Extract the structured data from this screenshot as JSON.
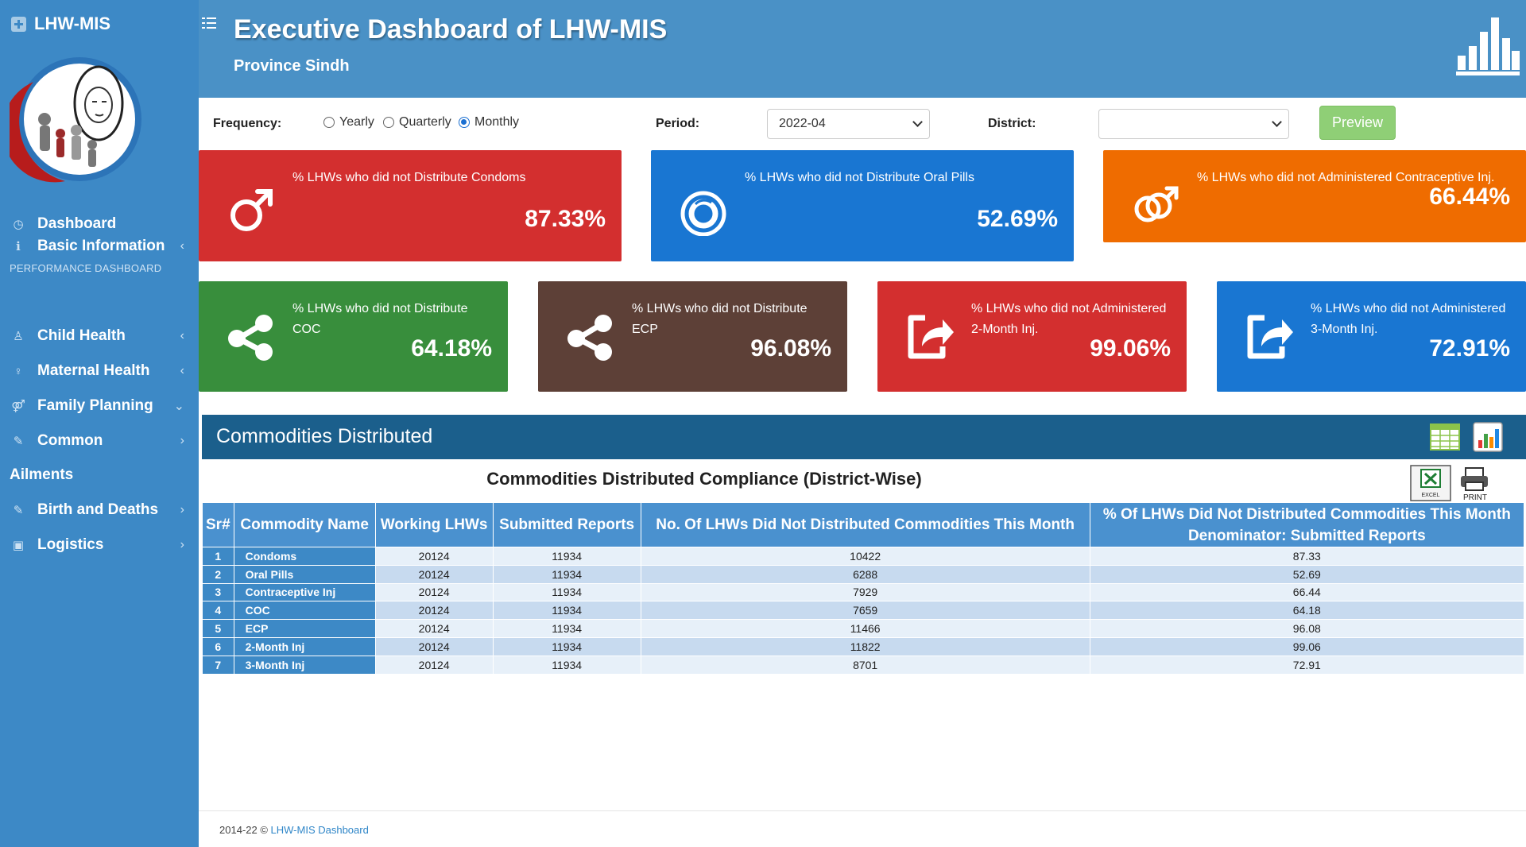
{
  "brand": {
    "name": "LHW-MIS"
  },
  "sidebar": {
    "dashboard": "Dashboard",
    "section_header": "PERFORMANCE DASHBOARD",
    "items": [
      {
        "label": "Basic Information",
        "chevron": "‹"
      },
      {
        "label": "Child Health",
        "chevron": "‹"
      },
      {
        "label": "Maternal Health",
        "chevron": "‹"
      },
      {
        "label": "Family Planning",
        "chevron": "⌄"
      },
      {
        "label": "Common",
        "chevron": "›"
      },
      {
        "label": "Ailments",
        "chevron": ""
      },
      {
        "label": "Birth and Deaths",
        "chevron": "›"
      },
      {
        "label": "Logistics",
        "chevron": "›"
      }
    ]
  },
  "header": {
    "title": "Executive Dashboard of LHW-MIS",
    "subtitle": "Province Sindh"
  },
  "filters": {
    "frequency_label": "Frequency:",
    "options": [
      "Yearly",
      "Quarterly",
      "Monthly"
    ],
    "selected": "Monthly",
    "period_label": "Period:",
    "period_value": "2022-04",
    "district_label": "District:",
    "district_value": "",
    "preview_label": "Preview"
  },
  "cards": [
    {
      "label": "% LHWs who did not Distribute Condoms",
      "value": "87.33%",
      "color": "#d32f2f",
      "icon": "male-symbol-icon"
    },
    {
      "label": "% LHWs who did not Distribute Oral Pills",
      "value": "52.69%",
      "color": "#1976d2",
      "icon": "pill-circle-icon"
    },
    {
      "label": "% LHWs who did not Administered Contraceptive Inj.",
      "value": "66.44%",
      "color": "#ef6c00",
      "icon": "venus-mars-icon"
    },
    {
      "label": "% LHWs who did not Distribute COC",
      "value": "64.18%",
      "color": "#388e3c",
      "icon": "share-icon"
    },
    {
      "label": "% LHWs who did not Distribute ECP",
      "value": "96.08%",
      "color": "#5d4037",
      "icon": "share-icon"
    },
    {
      "label": "% LHWs who did not Administered 2-Month Inj.",
      "value": "99.06%",
      "color": "#d32f2f",
      "icon": "share-arrow-icon"
    },
    {
      "label": "% LHWs who did not Administered 3-Month Inj.",
      "value": "72.91%",
      "color": "#1976d2",
      "icon": "share-arrow-icon"
    }
  ],
  "panel": {
    "title": "Commodities Distributed",
    "table_title": "Commodities Distributed Compliance (District-Wise)",
    "excel_label": "EXCEL",
    "print_label": "PRINT",
    "columns": [
      "Sr#",
      "Commodity Name",
      "Working LHWs",
      "Submitted Reports",
      "No. Of LHWs Did Not Distributed Commodities This Month",
      "% Of LHWs Did Not Distributed Commodities This Month",
      "Denominator: Submitted Reports"
    ],
    "rows": [
      [
        "1",
        "Condoms",
        "20124",
        "11934",
        "10422",
        "87.33"
      ],
      [
        "2",
        "Oral Pills",
        "20124",
        "11934",
        "6288",
        "52.69"
      ],
      [
        "3",
        "Contraceptive Inj",
        "20124",
        "11934",
        "7929",
        "66.44"
      ],
      [
        "4",
        "COC",
        "20124",
        "11934",
        "7659",
        "64.18"
      ],
      [
        "5",
        "ECP",
        "20124",
        "11934",
        "11466",
        "96.08"
      ],
      [
        "6",
        "2-Month Inj",
        "20124",
        "11934",
        "11822",
        "99.06"
      ],
      [
        "7",
        "3-Month Inj",
        "20124",
        "11934",
        "8701",
        "72.91"
      ]
    ]
  },
  "footer": {
    "prefix": "2014-22 © ",
    "link": "LHW-MIS Dashboard"
  }
}
